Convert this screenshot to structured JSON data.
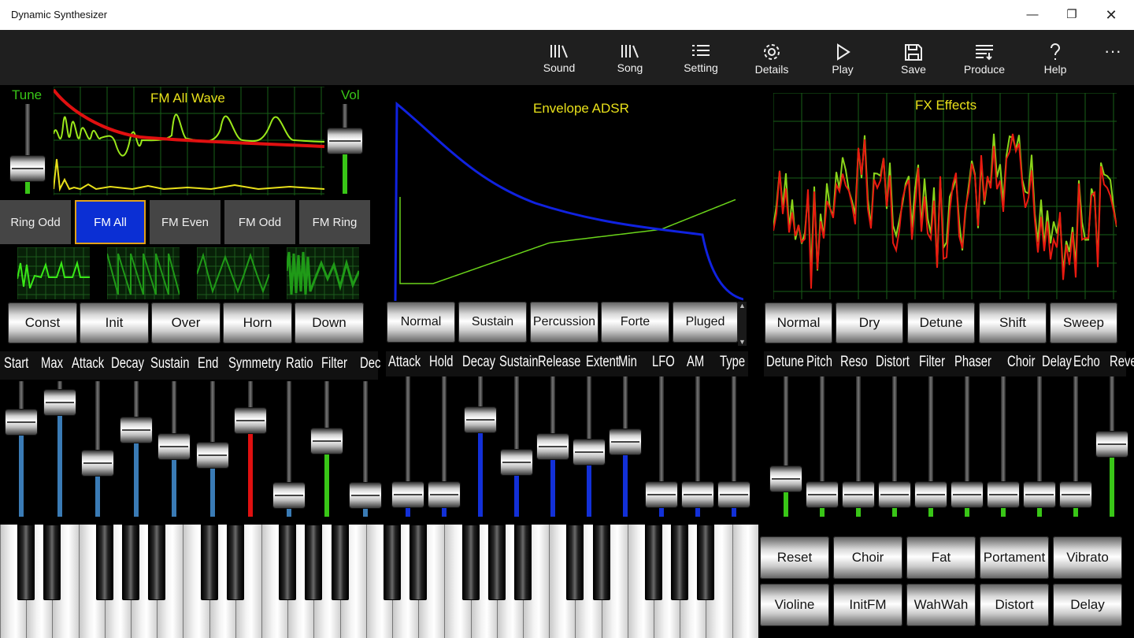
{
  "window": {
    "title": "Dynamic Synthesizer",
    "controls": [
      "minimize",
      "restore",
      "close"
    ]
  },
  "toolbar": {
    "items": [
      {
        "label": "Sound",
        "icon": "library-icon"
      },
      {
        "label": "Song",
        "icon": "library-icon"
      },
      {
        "label": "Setting",
        "icon": "list-icon"
      },
      {
        "label": "Details",
        "icon": "gear-icon"
      },
      {
        "label": "Play",
        "icon": "play-icon"
      },
      {
        "label": "Save",
        "icon": "save-icon"
      },
      {
        "label": "Produce",
        "icon": "produce-icon"
      },
      {
        "label": "Help",
        "icon": "help-icon"
      }
    ],
    "more": "···"
  },
  "wave_panel": {
    "tune_label": "Tune",
    "title": "FM All Wave",
    "vol_label": "Vol",
    "tune_value": 0.2,
    "vol_value": 0.62,
    "modes": [
      "Ring Odd",
      "FM All",
      "FM Even",
      "FM Odd",
      "FM Ring"
    ],
    "selected_mode": "FM All",
    "presets": [
      "Const",
      "Init",
      "Over",
      "Horn",
      "Down"
    ],
    "params": [
      "Start",
      "Max",
      "Attack",
      "Decay",
      "Sustain",
      "End",
      "Symmetry",
      "Ratio",
      "Filter",
      "Dec"
    ],
    "param_values": [
      0.74,
      0.92,
      0.37,
      0.67,
      0.52,
      0.44,
      0.76,
      0.08,
      0.57,
      0.08
    ],
    "param_colors": [
      "#3a7bb5",
      "#3a7bb5",
      "#3a7bb5",
      "#3a7bb5",
      "#3a7bb5",
      "#3a7bb5",
      "#e01010",
      "#3a7bb5",
      "#39c617",
      "#3a7bb5"
    ]
  },
  "envelope_panel": {
    "title": "Envelope ADSR",
    "presets": [
      "Normal",
      "Sustain",
      "Percussion",
      "Forte",
      "Pluged"
    ],
    "params": [
      "Attack",
      "Hold",
      "Decay",
      "Sustain",
      "Release",
      "Extent",
      "Min",
      "LFO",
      "AM",
      "Type"
    ],
    "param_values": [
      0.08,
      0.08,
      0.73,
      0.36,
      0.5,
      0.45,
      0.54,
      0.08,
      0.08,
      0.08
    ],
    "param_colors": [
      "#1230d8",
      "#1230d8",
      "#1230d8",
      "#1230d8",
      "#1230d8",
      "#1230d8",
      "#1230d8",
      "#1230d8",
      "#1230d8",
      "#1230d8"
    ]
  },
  "fx_panel": {
    "title": "FX Effects",
    "presets": [
      "Normal",
      "Dry",
      "Detune",
      "Shift",
      "Sweep"
    ],
    "params": [
      "Detune",
      "Pitch",
      "Reso",
      "Distort",
      "Filter",
      "Phaser",
      "Choir",
      "Delay",
      "Echo",
      "Reverb"
    ],
    "param_values": [
      0.22,
      0.08,
      0.08,
      0.08,
      0.08,
      0.08,
      0.08,
      0.08,
      0.08,
      0.52
    ],
    "param_colors": [
      "#39c617",
      "#39c617",
      "#39c617",
      "#39c617",
      "#39c617",
      "#39c617",
      "#39c617",
      "#39c617",
      "#39c617",
      "#39c617"
    ]
  },
  "quick_buttons": [
    "Reset",
    "Choir",
    "Fat",
    "Portament",
    "Vibrato",
    "Violine",
    "InitFM",
    "WahWah",
    "Distort",
    "Delay"
  ]
}
